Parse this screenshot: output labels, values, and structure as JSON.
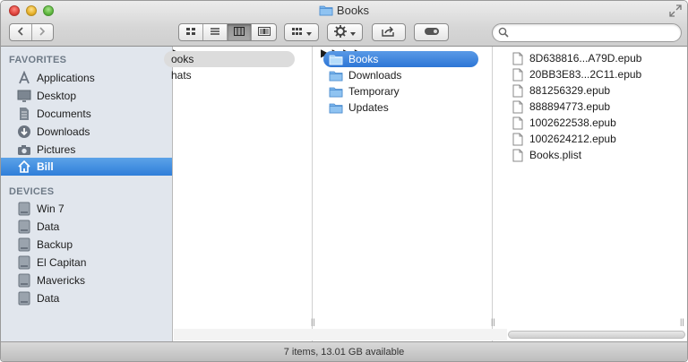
{
  "window": {
    "title": "Books"
  },
  "toolbar": {
    "back_icon": "chevron-left-icon",
    "forward_icon": "chevron-right-icon",
    "view_modes": [
      "icon-view",
      "list-view",
      "column-view",
      "coverflow-view"
    ],
    "active_view": "column-view",
    "arrange_icon": "arrange-grid-icon",
    "action_icon": "gear-icon",
    "share_icon": "share-icon",
    "tags_icon": "tag-pill-icon",
    "search_placeholder": ""
  },
  "sidebar": {
    "favorites_heading": "FAVORITES",
    "favorites": [
      {
        "label": "Applications",
        "icon": "applications-icon"
      },
      {
        "label": "Desktop",
        "icon": "desktop-icon"
      },
      {
        "label": "Documents",
        "icon": "documents-icon"
      },
      {
        "label": "Downloads",
        "icon": "downloads-icon"
      },
      {
        "label": "Pictures",
        "icon": "camera-icon"
      },
      {
        "label": "Bill",
        "icon": "home-icon",
        "selected": true
      }
    ],
    "devices_heading": "DEVICES",
    "devices": [
      {
        "label": "Win 7",
        "icon": "disk-icon"
      },
      {
        "label": "Data",
        "icon": "disk-icon"
      },
      {
        "label": "Backup",
        "icon": "disk-icon"
      },
      {
        "label": "El Capitan",
        "icon": "disk-icon"
      },
      {
        "label": "Mavericks",
        "icon": "disk-icon"
      },
      {
        "label": "Data",
        "icon": "disk-icon"
      }
    ]
  },
  "columns": {
    "col1": [
      {
        "label": "ooks",
        "selected": true,
        "has_children": true
      },
      {
        "label": "hats",
        "selected": false,
        "has_children": false
      }
    ],
    "col2": [
      {
        "label": "Books",
        "selected": true
      },
      {
        "label": "Downloads",
        "selected": false
      },
      {
        "label": "Temporary",
        "selected": false
      },
      {
        "label": "Updates",
        "selected": false
      }
    ],
    "col3": [
      {
        "label": "8D638816...A79D.epub"
      },
      {
        "label": "20BB3E83...2C11.epub"
      },
      {
        "label": "881256329.epub"
      },
      {
        "label": "888894773.epub"
      },
      {
        "label": "1002622538.epub"
      },
      {
        "label": "1002624212.epub"
      },
      {
        "label": "Books.plist"
      }
    ]
  },
  "status": {
    "text": "7 items, 13.01 GB available"
  },
  "colors": {
    "selection_blue": "#2f7ed9",
    "sidebar_bg": "#e1e6ed",
    "folder_blue": "#6aaee8"
  }
}
